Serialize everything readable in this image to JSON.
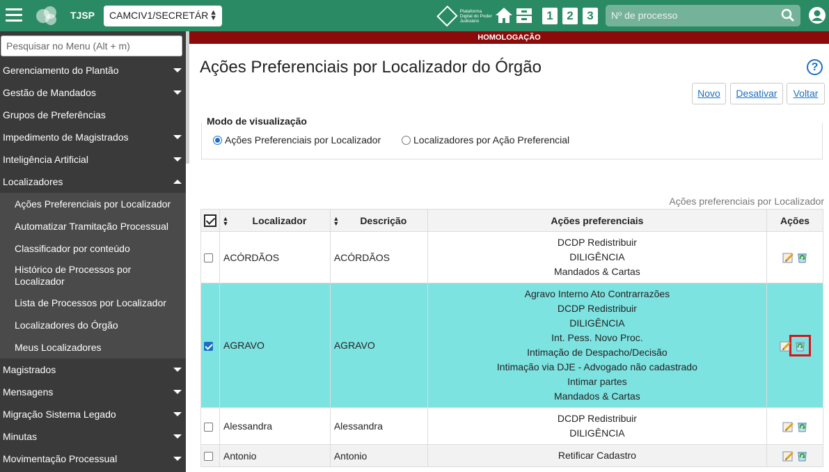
{
  "topbar": {
    "app_name": "TJSP",
    "org_select": "CAMCIV1/SECRETÁR",
    "pdpj_text": "Plataforma Digital do Poder Judiciário",
    "quick_numbers": [
      "1",
      "2",
      "3"
    ],
    "search_placeholder": "Nº de processo",
    "bg_color": "#2a8a63"
  },
  "sidebar": {
    "search_placeholder": "Pesquisar no Menu (Alt + m)",
    "items_before": [
      "Gerenciamento do Plantão",
      "Gestão de Mandados",
      "Grupos de Preferências",
      "Impedimento de Magistrados",
      "Inteligência Artificial",
      "Localizadores"
    ],
    "subitems": [
      "Ações Preferenciais por Localizador",
      "Automatizar Tramitação Processual",
      "Classificador por conteúdo",
      "Histórico de Processos por Localizador",
      "Lista de Processos por Localizador",
      "Localizadores do Órgão",
      "Meus Localizadores"
    ],
    "items_after": [
      "Magistrados",
      "Mensagens",
      "Migração Sistema Legado",
      "Minutas",
      "Movimentação Processual"
    ]
  },
  "banner": "HOMOLOGAÇÃO",
  "page": {
    "title": "Ações Preferenciais por Localizador do Órgão",
    "help": "?",
    "buttons": {
      "novo": "Novo",
      "desativar": "Desativar",
      "voltar": "Voltar"
    },
    "view_mode": {
      "legend": "Modo de visualização",
      "option1": "Ações Preferenciais por Localizador",
      "option2": "Localizadores por Ação Preferencial",
      "selected": "option1"
    },
    "table_caption": "Ações preferenciais por Localizador"
  },
  "table": {
    "headers": {
      "localizador": "Localizador",
      "descricao": "Descrição",
      "acoes_preferenciais": "Ações preferenciais",
      "acoes": "Ações"
    },
    "rows": [
      {
        "localizador": "ACÓRDÃOS",
        "descricao": "ACÓRDÃOS",
        "acoes": [
          "DCDP Redistribuir",
          "DILIGÊNCIA",
          "Mandados & Cartas"
        ],
        "checked": false
      },
      {
        "localizador": "AGRAVO",
        "descricao": "AGRAVO",
        "acoes": [
          "Agravo Interno Ato Contrarrazões",
          "DCDP Redistribuir",
          "DILIGÊNCIA",
          "Int. Pess. Novo Proc.",
          "Intimação de Despacho/Decisão",
          "Intimação via DJE - Advogado não cadastrado",
          "Intimar partes",
          "Mandados & Cartas"
        ],
        "checked": true
      },
      {
        "localizador": "Alessandra",
        "descricao": "Alessandra",
        "acoes": [
          "DCDP Redistribuir",
          "DILIGÊNCIA"
        ],
        "checked": false
      },
      {
        "localizador": "Antonio",
        "descricao": "Antonio",
        "acoes": [
          "Retificar Cadastro"
        ],
        "checked": false
      }
    ]
  }
}
